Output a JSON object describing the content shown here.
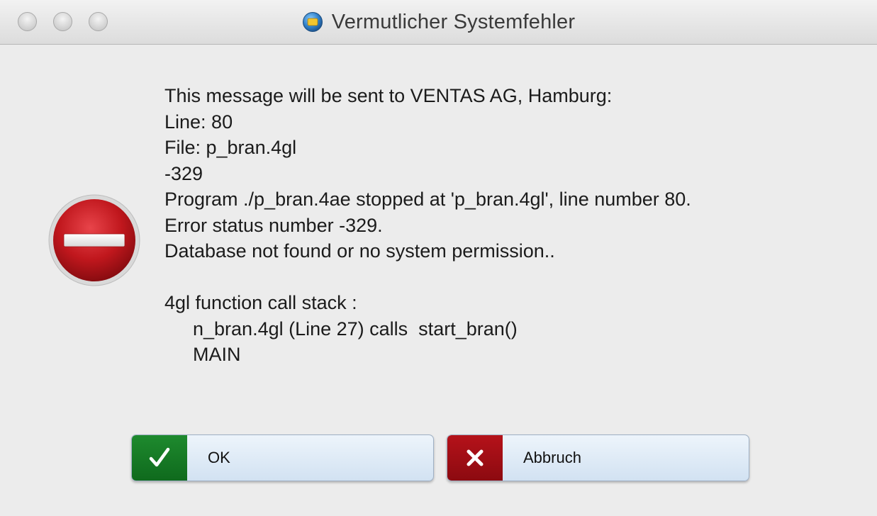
{
  "window": {
    "title": "Vermutlicher Systemfehler"
  },
  "message": {
    "lines": [
      "This message will be sent to VENTAS AG, Hamburg:",
      "Line: 80",
      "File: p_bran.4gl",
      "-329",
      "Program ./p_bran.4ae stopped at 'p_bran.4gl', line number 80.",
      "Error status number -329.",
      "Database not found or no system permission..",
      "",
      "4gl function call stack :",
      "n_bran.4gl (Line 27) calls  start_bran()",
      "MAIN"
    ]
  },
  "buttons": {
    "ok_label": "OK",
    "ok_icon": "checkmark-icon",
    "cancel_label": "Abbruch",
    "cancel_icon": "cross-icon"
  },
  "icons": {
    "alert": "stop-sign-icon",
    "app": "app-icon"
  },
  "colors": {
    "ok_accent": "#1e8a2e",
    "cancel_accent": "#b5121a",
    "stop_red": "#c0171d"
  }
}
